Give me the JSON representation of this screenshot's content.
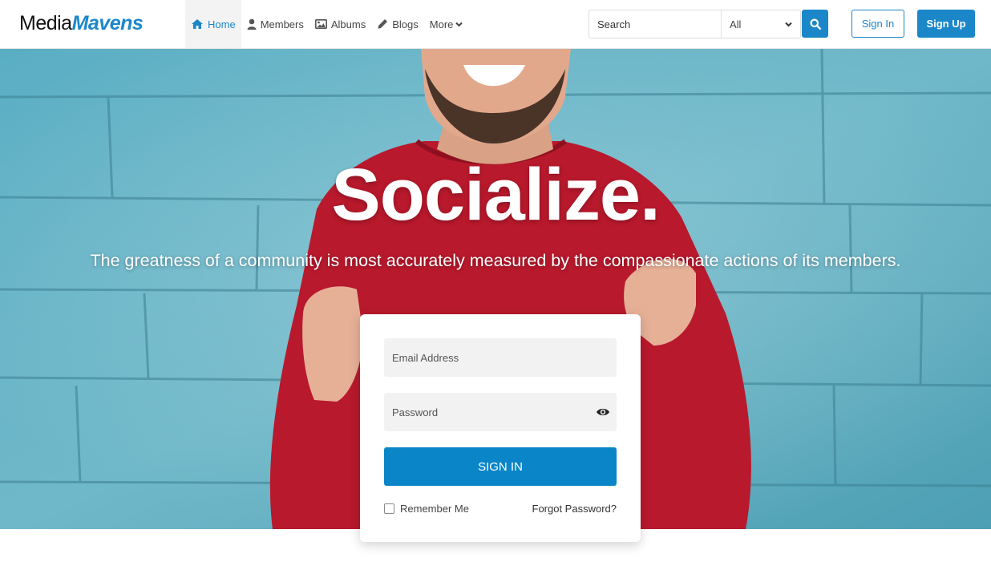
{
  "brand": {
    "name_part1": "Media",
    "name_part2": "Mavens",
    "accent": "#1b87c9"
  },
  "nav": {
    "items": [
      {
        "label": "Home",
        "icon": "home-icon",
        "active": true
      },
      {
        "label": "Members",
        "icon": "user-icon",
        "active": false
      },
      {
        "label": "Albums",
        "icon": "image-icon",
        "active": false
      },
      {
        "label": "Blogs",
        "icon": "pencil-icon",
        "active": false
      },
      {
        "label": "More",
        "icon": "chevron-down-icon",
        "active": false
      }
    ]
  },
  "search": {
    "placeholder": "Search",
    "scope_selected": "All",
    "button_icon": "search-icon"
  },
  "auth": {
    "signin_label": "Sign In",
    "signup_label": "Sign Up"
  },
  "hero": {
    "title": "Socialize.",
    "subtitle": "The greatness of a community is most accurately measured by the compassionate actions of its members."
  },
  "login_form": {
    "email_placeholder": "Email Address",
    "password_placeholder": "Password",
    "password_toggle_icon": "eye-icon",
    "submit_label": "SIGN IN",
    "remember_label": "Remember Me",
    "remember_checked": false,
    "forgot_label": "Forgot Password?"
  },
  "colors": {
    "primary": "#0a85c8",
    "wall": "#4fa6bd",
    "sweater": "#b8192c"
  }
}
